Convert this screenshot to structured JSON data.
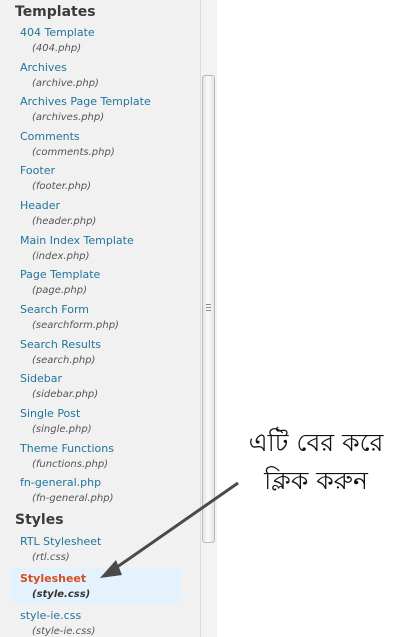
{
  "sections": [
    {
      "heading": "Templates",
      "items": [
        {
          "name": "404 Template",
          "file": "(404.php)"
        },
        {
          "name": "Archives",
          "file": "(archive.php)"
        },
        {
          "name": "Archives Page Template",
          "file": "(archives.php)"
        },
        {
          "name": "Comments",
          "file": "(comments.php)"
        },
        {
          "name": "Footer",
          "file": "(footer.php)"
        },
        {
          "name": "Header",
          "file": "(header.php)"
        },
        {
          "name": "Main Index Template",
          "file": "(index.php)"
        },
        {
          "name": "Page Template",
          "file": "(page.php)"
        },
        {
          "name": "Search Form",
          "file": "(searchform.php)"
        },
        {
          "name": "Search Results",
          "file": "(search.php)"
        },
        {
          "name": "Sidebar",
          "file": "(sidebar.php)"
        },
        {
          "name": "Single Post",
          "file": "(single.php)"
        },
        {
          "name": "Theme Functions",
          "file": "(functions.php)"
        },
        {
          "name": "fn-general.php",
          "file": "(fn-general.php)"
        }
      ]
    },
    {
      "heading": "Styles",
      "items": [
        {
          "name": "RTL Stylesheet",
          "file": "(rtl.css)"
        },
        {
          "name": "Stylesheet",
          "file": "(style.css)",
          "active": true
        },
        {
          "name": "style-ie.css",
          "file": "(style-ie.css)"
        }
      ]
    }
  ],
  "annotation": {
    "line1": "এটি বের করে",
    "line2": "ক্লিক করুন"
  },
  "colors": {
    "link": "#21759b",
    "active_link": "#d54e21",
    "active_bg": "#e4f2fd",
    "panel_bg": "#f1f1f1"
  }
}
